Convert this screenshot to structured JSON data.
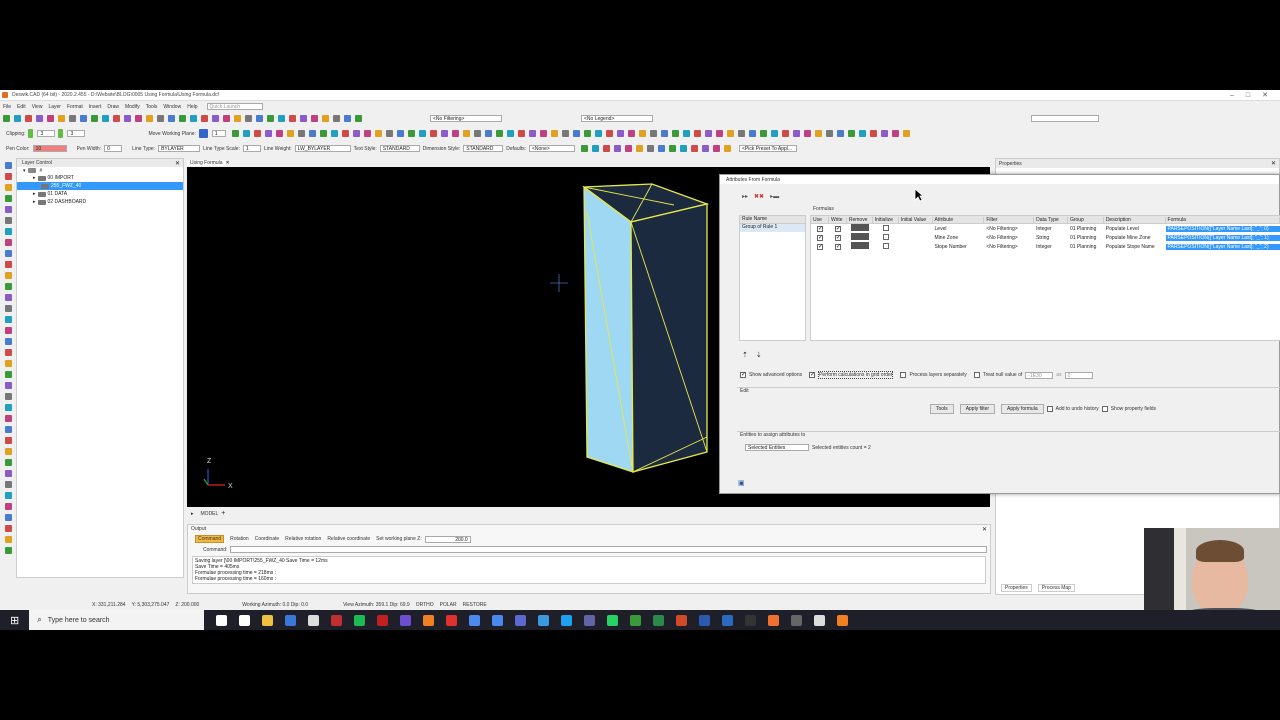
{
  "window": {
    "title": "Deswik.CAD (64 bit) - 2020.2.455 - D:\\Website\\BLOG\\0005 Using Formula\\Using Formula.dcf"
  },
  "menu": [
    "File",
    "Edit",
    "View",
    "Layer",
    "Format",
    "Insert",
    "Draw",
    "Modify",
    "Tools",
    "Window",
    "Help"
  ],
  "quick_launch": "Quick Launch",
  "toolbar": {
    "filtering": "<No Filtering>",
    "legend": "<No Legend>",
    "clipping_label": "Clipping:",
    "clip_a": "3",
    "clip_b": "3",
    "move_plane": "Move Working Plane:",
    "plane_val": "1",
    "pen_color_label": "Pen Color:",
    "pen_color": "10",
    "pen_width_label": "Pen Width:",
    "pen_width": "0",
    "line_type_label": "Line Type:",
    "line_type": "BYLAYER",
    "line_scale_label": "Line Type Scale:",
    "line_scale": "1",
    "line_weight_label": "Line Weight:",
    "line_weight": "LW_BYLAYER",
    "text_style_label": "Text Style:",
    "text_style": "STANDARD",
    "dim_style_label": "Dimension Style:",
    "dim_style": "STANDARD",
    "defaults_label": "Defaults:",
    "defaults": "<None>",
    "preset": "<Pick Preset To Appl..."
  },
  "layer_control": {
    "title": "Layer Control",
    "items": [
      {
        "label": "00 IMPORT",
        "depth": 1
      },
      {
        "label": "255_FWZ_40",
        "depth": 2,
        "selected": true
      },
      {
        "label": "01 DATA",
        "depth": 1
      },
      {
        "label": "02 DASHBOARD",
        "depth": 1
      }
    ]
  },
  "doc_tab": "Using Formula",
  "model_tab": "MODEL",
  "properties": {
    "title": "Properties",
    "tabs": [
      "Properties",
      "Process Map"
    ]
  },
  "dialog": {
    "title": "Attributes From Formula",
    "rule_header": "Rule Name",
    "rule": "Group of Rule 1",
    "formulas_label": "Formulas",
    "columns": [
      "Use",
      "Write",
      "Remove",
      "Initialize",
      "Initial Value",
      "Attribute",
      "Filter",
      "Data Type",
      "Group",
      "Description",
      "Formula"
    ],
    "rows": [
      {
        "attribute": "Level",
        "filter": "<No Filtering>",
        "type": "Integer",
        "group": "01 Planning",
        "desc": "Populate Level",
        "formula": "PARSEPOSITION([\"Layer Name Last]; \"_\"; 0)"
      },
      {
        "attribute": "Mine Zone",
        "filter": "<No Filtering>",
        "type": "String",
        "group": "01 Planning",
        "desc": "Populate Mine Zone",
        "formula": "PARSEPOSITION([\"Layer Name Last]; \"_\"; 1)"
      },
      {
        "attribute": "Stope Number",
        "filter": "<No Filtering>",
        "type": "Integer",
        "group": "01 Planning",
        "desc": "Populate Stope Name",
        "formula": "PARSEPOSITION([\"Layer Name Last]; \"_\"; 2)"
      }
    ],
    "opt_advanced": "Show advanced options",
    "opt_grid": "Perform calculations in grid order",
    "opt_separate": "Process layers separately",
    "opt_null": "Treat null value of",
    "null_val": "-1E30",
    "as_label": "as",
    "as_val": "0",
    "edit_label": "Edit",
    "tools_btn": "Tools",
    "apply_filter": "Apply filter",
    "apply_formula": "Apply formula",
    "undo_hist": "Add to undo history",
    "show_fields": "Show property fields",
    "entities_label": "Entities to assign attributes to",
    "entities_sel": "Selected Entities",
    "entities_count": "Selected entities count = 2"
  },
  "output": {
    "title": "Output",
    "tabs": [
      "Command",
      "Rotation",
      "Coordinate",
      "Relative rotation",
      "Relative coordinate",
      "Set working plane Z:"
    ],
    "plane_z": "200.0",
    "command_label": "Command:",
    "lines": [
      "Saving layer [\\00 IMPORT\\255_FWZ_40  Save Time = 12ms",
      "Save Time = 405ms",
      "Formulae processing time = 218ms :",
      "Formulae processing time = 160ms :"
    ]
  },
  "status": {
    "x": "X: 331,211.284",
    "y": "Y: 5,303,275.047",
    "z": "Z: 200.000",
    "working": "Working Azimuth: 0.0 Dip: 0.0",
    "view": "View Azimuth: 359.1 Dip: 69.9",
    "modes": [
      "ORTHO",
      "POLAR",
      "RESTORE"
    ]
  },
  "axis": {
    "z": "Z",
    "x": "X"
  },
  "taskbar": {
    "search": "Type here to search"
  },
  "colors": {
    "viewport": "#000000",
    "prism_face": "#9fd8f3",
    "prism_dark": "#1c2a3f",
    "prism_edge": "#e6e84a",
    "selection": "#3399ff",
    "pen_swatch": "#f08080"
  }
}
